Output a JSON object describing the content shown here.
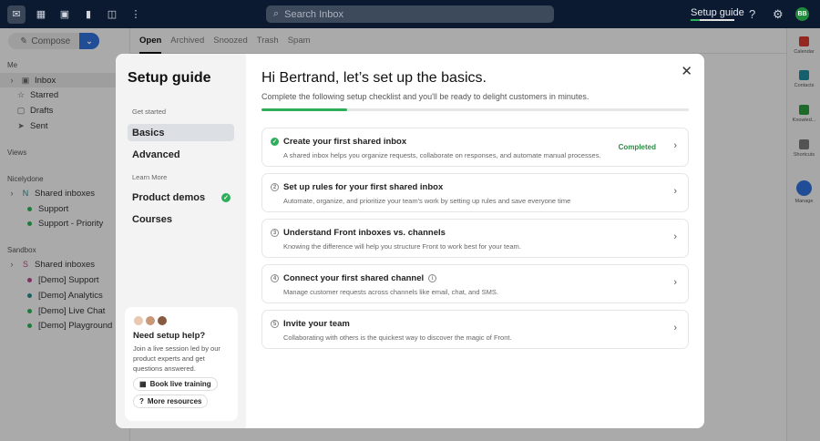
{
  "topbar": {
    "search_placeholder": "Search Inbox",
    "setup_guide": "Setup guide",
    "setup_progress": 0.2,
    "avatar": "BB"
  },
  "sidebar": {
    "compose": "Compose",
    "me": "Me",
    "items": [
      "Inbox",
      "Starred",
      "Drafts",
      "Sent"
    ],
    "views": "Views",
    "team1": "Nicelydone",
    "team1_group": "Shared inboxes",
    "team1_items": [
      "Support",
      "Support - Priority"
    ],
    "team2": "Sandbox",
    "team2_group": "Shared inboxes",
    "team2_items": [
      "[Demo] Support",
      "[Demo] Analytics",
      "[Demo] Live Chat",
      "[Demo] Playground"
    ]
  },
  "tabs": [
    "Open",
    "Archived",
    "Snoozed",
    "Trash",
    "Spam"
  ],
  "right_bar": [
    "Calendar",
    "Contacts",
    "Knowled...",
    "Shortcuts",
    "Manage"
  ],
  "modal": {
    "title": "Setup guide",
    "get_started": "Get started",
    "basics": "Basics",
    "advanced": "Advanced",
    "learn_more": "Learn More",
    "product_demos": "Product demos",
    "courses": "Courses",
    "help": {
      "title": "Need setup help?",
      "text": "Join a live session led by our product experts and get questions answered.",
      "book": "Book live training",
      "more": "More resources"
    },
    "heading": "Hi Bertrand, let’s set up the basics.",
    "subtitle": "Complete the following setup checklist and you'll be ready to delight customers in minutes.",
    "progress": 0.2,
    "steps": [
      {
        "num": "✓",
        "title": "Create your first shared inbox",
        "desc": "A shared inbox helps you organize requests, collaborate on responses, and automate manual processes.",
        "status": "Completed"
      },
      {
        "num": "2",
        "title": "Set up rules for your first shared inbox",
        "desc": "Automate, organize, and prioritize your team's work by setting up rules and save everyone time"
      },
      {
        "num": "3",
        "title": "Understand Front inboxes vs. channels",
        "desc": "Knowing the difference will help you structure Front to work best for your team."
      },
      {
        "num": "4",
        "title": "Connect your first shared channel",
        "desc": "Manage customer requests across channels like email, chat, and SMS."
      },
      {
        "num": "5",
        "title": "Invite your team",
        "desc": "Collaborating with others is the quickest way to discover the magic of Front."
      }
    ]
  }
}
